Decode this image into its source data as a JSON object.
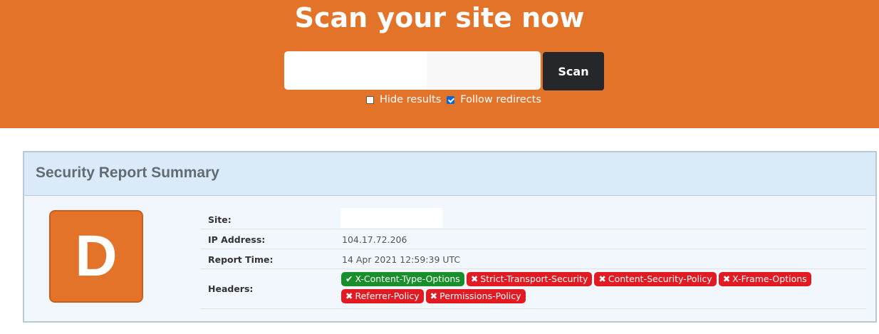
{
  "hero": {
    "title": "Scan your site now",
    "search": {
      "value": "",
      "placeholder": ""
    },
    "scan_label": "Scan",
    "options": [
      {
        "label": "Hide results",
        "checked": false
      },
      {
        "label": "Follow redirects",
        "checked": true
      }
    ]
  },
  "report": {
    "title": "Security Report Summary",
    "grade": "D",
    "rows": {
      "site": {
        "label": "Site:",
        "value": ""
      },
      "ip": {
        "label": "IP Address:",
        "value": "104.17.72.206"
      },
      "time": {
        "label": "Report Time:",
        "value": "14 Apr 2021 12:59:39 UTC"
      },
      "headers": {
        "label": "Headers:"
      }
    },
    "headers": [
      {
        "name": "X-Content-Type-Options",
        "status": "pass",
        "icon": "check-icon"
      },
      {
        "name": "Strict-Transport-Security",
        "status": "fail",
        "icon": "x-icon"
      },
      {
        "name": "Content-Security-Policy",
        "status": "fail",
        "icon": "x-icon"
      },
      {
        "name": "X-Frame-Options",
        "status": "fail",
        "icon": "x-icon"
      },
      {
        "name": "Referrer-Policy",
        "status": "fail",
        "icon": "x-icon"
      },
      {
        "name": "Permissions-Policy",
        "status": "fail",
        "icon": "x-icon"
      }
    ]
  },
  "colors": {
    "accent": "#e4732a",
    "pass": "#198f2c",
    "fail": "#e21a22",
    "dark_button": "#25272b"
  }
}
